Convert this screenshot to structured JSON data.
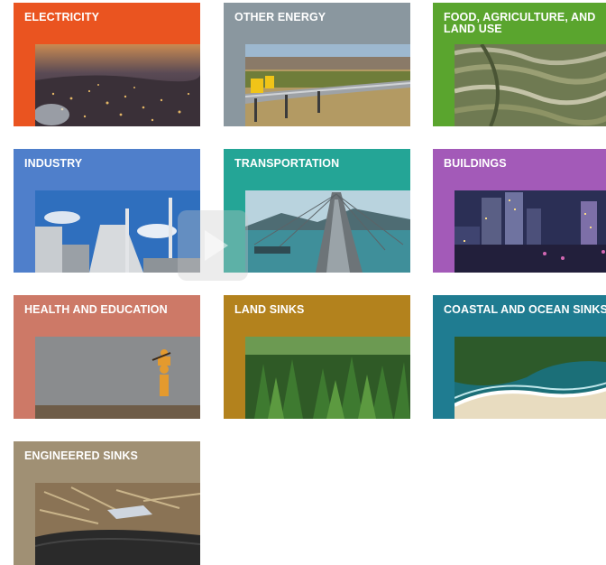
{
  "tiles": [
    {
      "label": "ELECTRICITY",
      "color": "#ea5420",
      "image": "city-night-lights"
    },
    {
      "label": "OTHER ENERGY",
      "color": "#8a979f",
      "image": "pipeline"
    },
    {
      "label": "FOOD, AGRICULTURE, AND LAND USE",
      "color": "#5aa52e",
      "image": "terraced-fields"
    },
    {
      "label": "INDUSTRY",
      "color": "#4f7fcb",
      "image": "industrial-plant"
    },
    {
      "label": "TRANSPORTATION",
      "color": "#24a596",
      "image": "bridge"
    },
    {
      "label": "BUILDINGS",
      "color": "#a35ab8",
      "image": "city-skyline"
    },
    {
      "label": "HEALTH AND EDUCATION",
      "color": "#cd7967",
      "image": "child-on-shoulders"
    },
    {
      "label": "LAND SINKS",
      "color": "#b3821d",
      "image": "forest"
    },
    {
      "label": "COASTAL AND OCEAN SINKS",
      "color": "#1f7c91",
      "image": "ocean-coast"
    },
    {
      "label": "ENGINEERED SINKS",
      "color": "#a09074",
      "image": "biochar"
    }
  ],
  "overlay": {
    "icon": "play-icon"
  }
}
